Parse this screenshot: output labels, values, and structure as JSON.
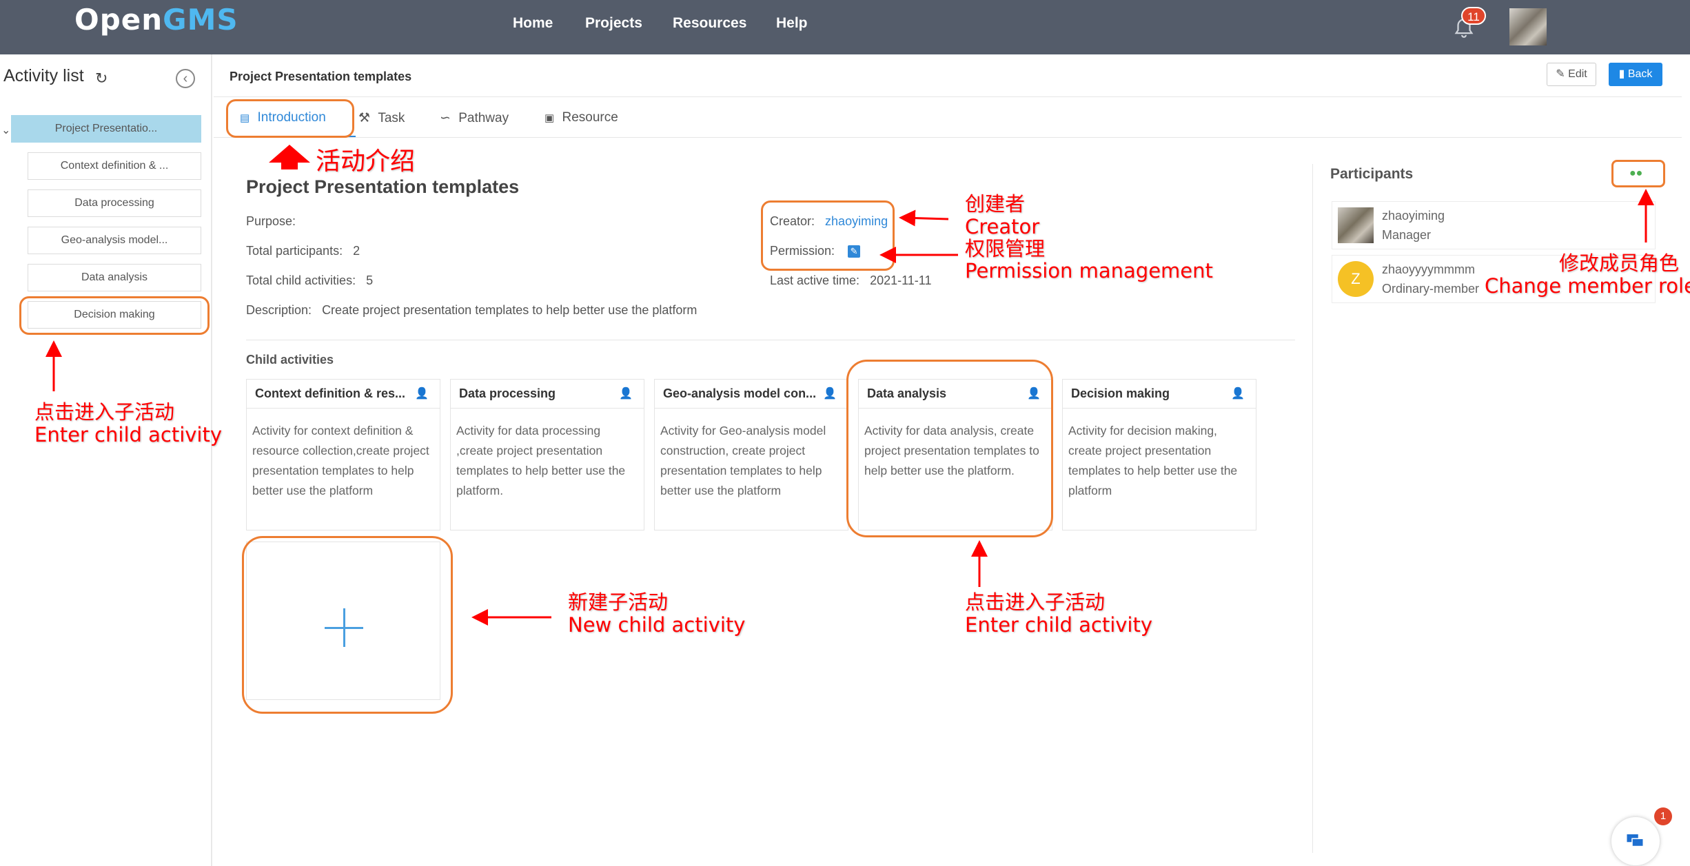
{
  "nav": {
    "logo_part1": "Open",
    "logo_part2": "GMS",
    "links": [
      "Home",
      "Projects",
      "Resources",
      "Help"
    ],
    "notification_count": "11",
    "bell_icon": "bell-icon"
  },
  "sidebar": {
    "title": "Activity list",
    "root": "Project Presentatio...",
    "items": [
      "Context definition & ...",
      "Data processing",
      "Geo-analysis model...",
      "Data analysis",
      "Decision making"
    ]
  },
  "header": {
    "title": "Project Presentation templates",
    "edit_label": "Edit",
    "back_label": "Back"
  },
  "tabs": [
    "Introduction",
    "Task",
    "Pathway",
    "Resource"
  ],
  "intro": {
    "title": "Project Presentation templates",
    "purpose_label": "Purpose:",
    "participants_label": "Total participants:",
    "participants_value": "2",
    "child_count_label": "Total child activities:",
    "child_count_value": "5",
    "description_label": "Description:",
    "description_value": "Create project presentation templates to help better use the platform",
    "creator_label": "Creator:",
    "creator_value": "zhaoyiming",
    "permission_label": "Permission:",
    "last_active_label": "Last active time:",
    "last_active_value": "2021-11-11"
  },
  "child_activities": {
    "title": "Child activities",
    "cards": [
      {
        "title": "Context definition & res...",
        "desc": "Activity for context definition & resource collection,create project presentation templates to help better use the platform"
      },
      {
        "title": "Data processing",
        "desc": "Activity for data processing ,create project presentation templates to help better use the platform."
      },
      {
        "title": "Geo-analysis model con...",
        "desc": "Activity for Geo-analysis model construction, create project presentation templates to help better use the platform"
      },
      {
        "title": "Data analysis",
        "desc": "Activity for data analysis, create project presentation templates to help better use the platform."
      },
      {
        "title": "Decision making",
        "desc": "Activity for decision making, create project presentation templates to help better use the platform"
      }
    ]
  },
  "participants": {
    "title": "Participants",
    "members": [
      {
        "name": "zhaoyiming",
        "role": "Manager"
      },
      {
        "name": "zhaoyyyymmmm",
        "role": "Ordinary-member",
        "initial": "Z"
      }
    ]
  },
  "chat": {
    "badge": "1"
  },
  "annotations": {
    "intro": "活动介绍",
    "creator_cn": "创建者",
    "creator_en": "Creator",
    "perm_cn": "权限管理",
    "perm_en": "Permission management",
    "role_cn": "修改成员角色",
    "role_en": "Change member role",
    "enter_cn": "点击进入子活动",
    "enter_en": "Enter child activity",
    "new_cn": "新建子活动",
    "new_en": "New child activity"
  },
  "colors": {
    "nav_bg": "#545c6a",
    "accent": "#2f88d8",
    "highlight": "#ed7d31",
    "annotation": "#ff0000",
    "selected_node": "#a9d8eb"
  }
}
